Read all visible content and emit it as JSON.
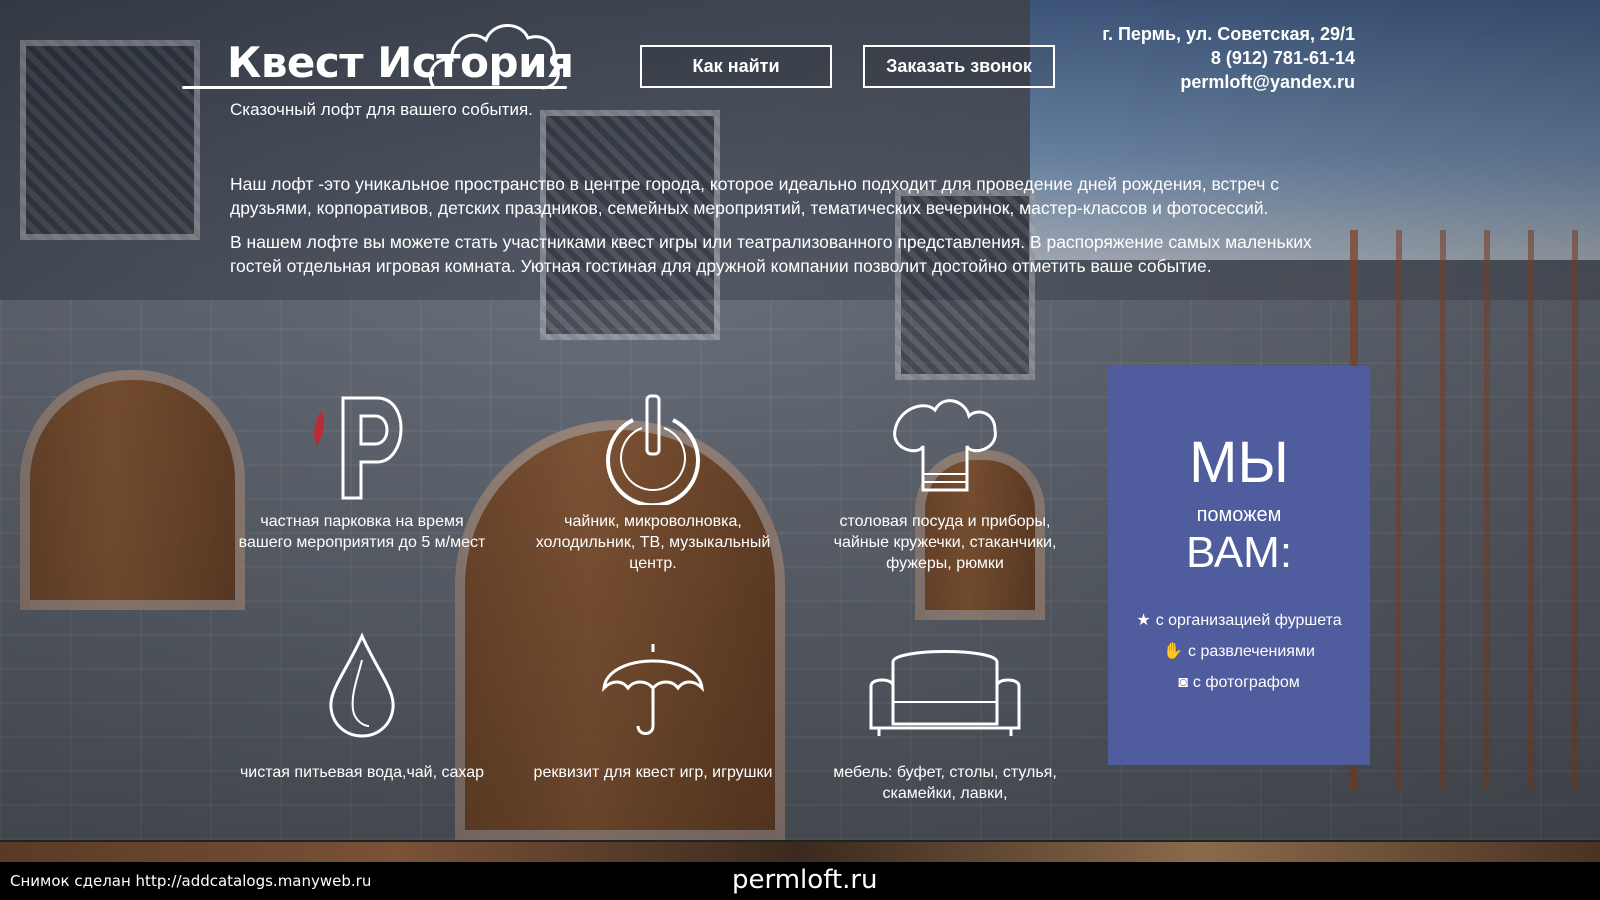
{
  "header": {
    "logo_title": "Квест История",
    "tagline": "Сказочный лофт для вашего события.",
    "buttons": {
      "find": "Как найти",
      "call": "Заказать звонок"
    },
    "contacts": {
      "address": "г. Пермь, ул. Советская, 29/1",
      "phone": "8 (912) 781-61-14",
      "email": "permloft@yandex.ru"
    }
  },
  "intro": {
    "paragraph1": "Наш лофт -это уникальное пространство в центре города, которое идеально подходит для проведение дней рождения, встреч с друзьями, корпоративов, детских праздников, семейных мероприятий, тематических вечеринок, мастер-классов и фотосессий.",
    "paragraph2": "В нашем лофте вы можете стать участниками квест игры или театрализованного представления. В распоряжение самых маленьких гостей отдельная игровая комната. Уютная гостиная для дружной компании позволит достойно отметить ваше событие."
  },
  "features": [
    {
      "icon": "parking-icon",
      "text": "частная парковка на время вашего мероприятия до 5 м/мест"
    },
    {
      "icon": "power-icon",
      "text": "чайник, микроволновка, холодильник, ТВ, музыкальный центр."
    },
    {
      "icon": "chef-hat-icon",
      "text": "столовая посуда и приборы, чайные кружечки, стаканчики, фужеры, рюмки"
    },
    {
      "icon": "water-drop-icon",
      "text": "чистая питьевая вода,чай, сахар"
    },
    {
      "icon": "umbrella-icon",
      "text": "реквизит для квест игр, игрушки"
    },
    {
      "icon": "sofa-icon",
      "text": "мебель: буфет, столы, стулья, скамейки, лавки,"
    }
  ],
  "help_panel": {
    "line1": "МЫ",
    "line2": "поможем",
    "line3": "ВАМ:",
    "items": [
      {
        "icon": "star-icon",
        "label": "с организацией фуршета"
      },
      {
        "icon": "hand-icon",
        "label": "с развлечениями"
      },
      {
        "icon": "camera-icon",
        "label": "с фотографом"
      }
    ],
    "color": "#4f5d9e"
  },
  "footer": {
    "screenshot_note": "Снимок сделан http://addcatalogs.manyweb.ru",
    "site": "permloft.ru"
  }
}
